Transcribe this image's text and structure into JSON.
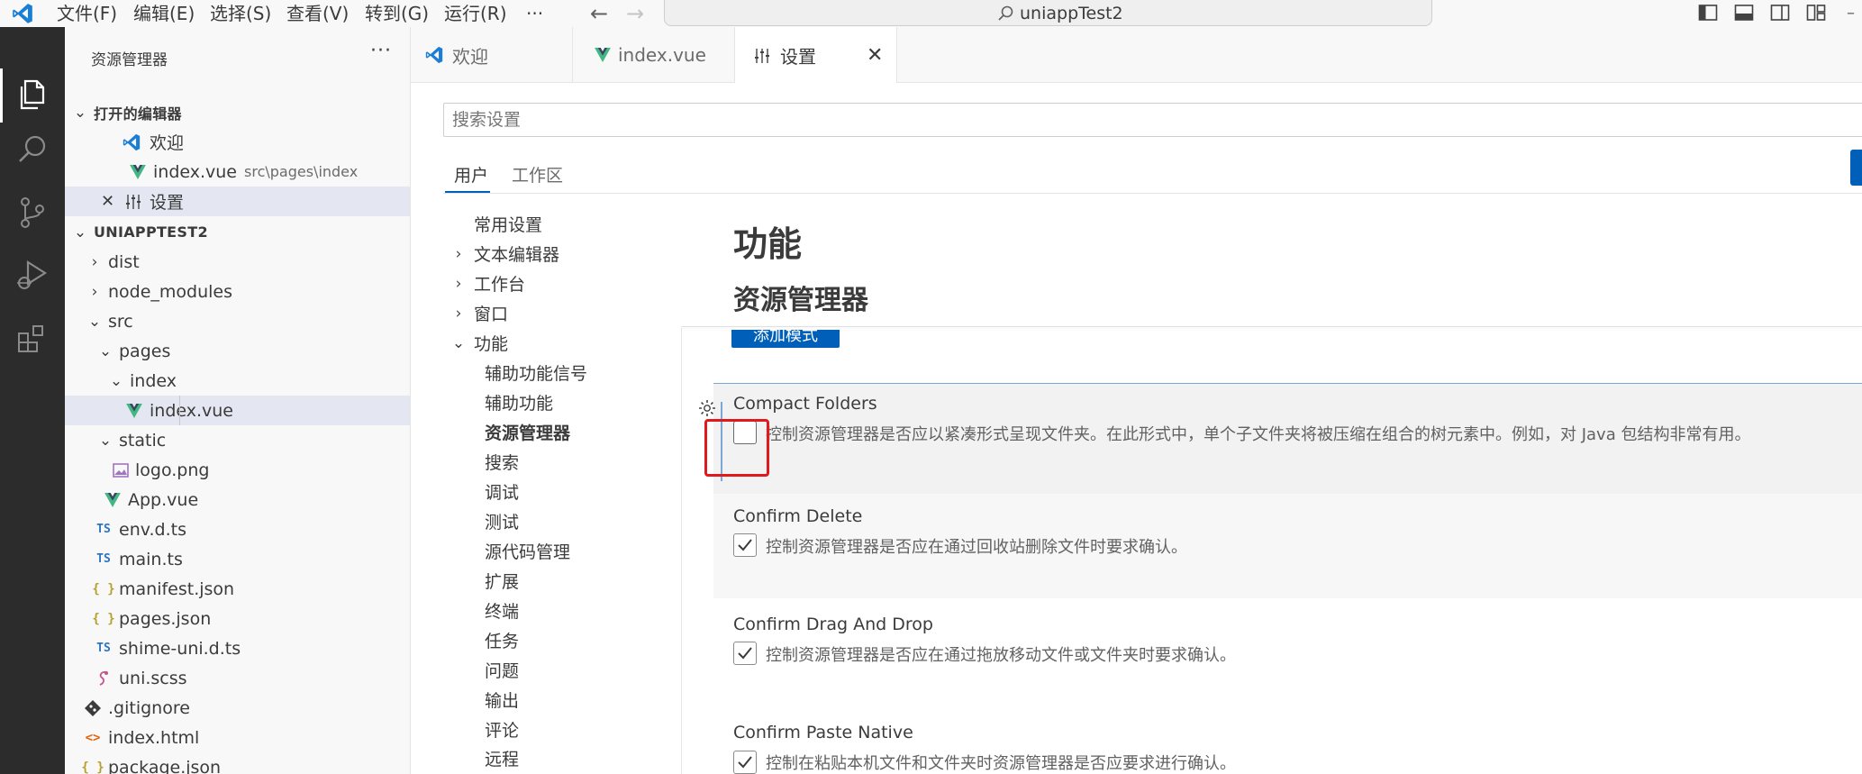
{
  "menu": [
    "文件(F)",
    "编辑(E)",
    "选择(S)",
    "查看(V)",
    "转到(G)",
    "运行(R)",
    "···"
  ],
  "command_center": {
    "label": "uniappTest2"
  },
  "activity_bar": [
    "explorer-icon",
    "search-icon",
    "source-control-icon",
    "run-debug-icon",
    "extensions-icon"
  ],
  "sidebar": {
    "title": "资源管理器",
    "more": "···",
    "open_editors": {
      "label": "打开的编辑器",
      "items": [
        {
          "label": "欢迎",
          "desc": ""
        },
        {
          "label": "index.vue",
          "desc": "src\\pages\\index"
        },
        {
          "label": "设置",
          "desc": ""
        }
      ]
    },
    "project": {
      "label": "UNIAPPTEST2",
      "items": [
        {
          "label": "dist",
          "kind": "folder"
        },
        {
          "label": "node_modules",
          "kind": "folder"
        },
        {
          "label": "src",
          "kind": "folder-open"
        },
        {
          "label": "pages",
          "kind": "folder-open"
        },
        {
          "label": "index",
          "kind": "folder-open"
        },
        {
          "label": "index.vue",
          "kind": "vue"
        },
        {
          "label": "static",
          "kind": "folder-open"
        },
        {
          "label": "logo.png",
          "kind": "image"
        },
        {
          "label": "App.vue",
          "kind": "vue"
        },
        {
          "label": "env.d.ts",
          "kind": "ts"
        },
        {
          "label": "main.ts",
          "kind": "ts"
        },
        {
          "label": "manifest.json",
          "kind": "json"
        },
        {
          "label": "pages.json",
          "kind": "json"
        },
        {
          "label": "shime-uni.d.ts",
          "kind": "ts"
        },
        {
          "label": "uni.scss",
          "kind": "scss"
        },
        {
          "label": ".gitignore",
          "kind": "git"
        },
        {
          "label": "index.html",
          "kind": "html"
        },
        {
          "label": "package.json",
          "kind": "json"
        }
      ]
    },
    "icons": {
      "ts": "TS",
      "json": "{ }",
      "html": "<>"
    }
  },
  "tabs": [
    {
      "label": "欢迎"
    },
    {
      "label": "index.vue"
    },
    {
      "label": "设置",
      "active": true
    }
  ],
  "settings": {
    "search_placeholder": "搜索设置",
    "scopes": [
      "用户",
      "工作区"
    ],
    "toc": [
      {
        "label": "常用设置",
        "chev": ""
      },
      {
        "label": "文本编辑器",
        "chev": "›"
      },
      {
        "label": "工作台",
        "chev": "›"
      },
      {
        "label": "窗口",
        "chev": "›"
      },
      {
        "label": "功能",
        "chev": "⌄"
      },
      {
        "label": "辅助功能信号"
      },
      {
        "label": "辅助功能"
      },
      {
        "label": "资源管理器",
        "bold": true
      },
      {
        "label": "搜索"
      },
      {
        "label": "调试"
      },
      {
        "label": "测试"
      },
      {
        "label": "源代码管理"
      },
      {
        "label": "扩展"
      },
      {
        "label": "终端"
      },
      {
        "label": "任务"
      },
      {
        "label": "问题"
      },
      {
        "label": "输出"
      },
      {
        "label": "评论"
      },
      {
        "label": "远程"
      }
    ],
    "group_heading": "功能",
    "section_heading": "资源管理器",
    "add_pattern_button": "添加模式",
    "items": [
      {
        "title": "Compact Folders",
        "checked": false,
        "desc": "控制资源管理器是否应以紧凑形式呈现文件夹。在此形式中，单个子文件夹将被压缩在组合的树元素中。例如，对 Java 包结构非常有用。"
      },
      {
        "title": "Confirm Delete",
        "checked": true,
        "desc": "控制资源管理器是否应在通过回收站删除文件时要求确认。"
      },
      {
        "title": "Confirm Drag And Drop",
        "checked": true,
        "desc": "控制资源管理器是否应在通过拖放移动文件或文件夹时要求确认。"
      },
      {
        "title": "Confirm Paste Native",
        "checked": true,
        "desc": "控制在粘贴本机文件和文件夹时资源管理器是否应要求进行确认。"
      }
    ]
  },
  "colors": {
    "accent": "#005fb8",
    "highlight": "#e0191a",
    "vue_green": "#41b883"
  }
}
